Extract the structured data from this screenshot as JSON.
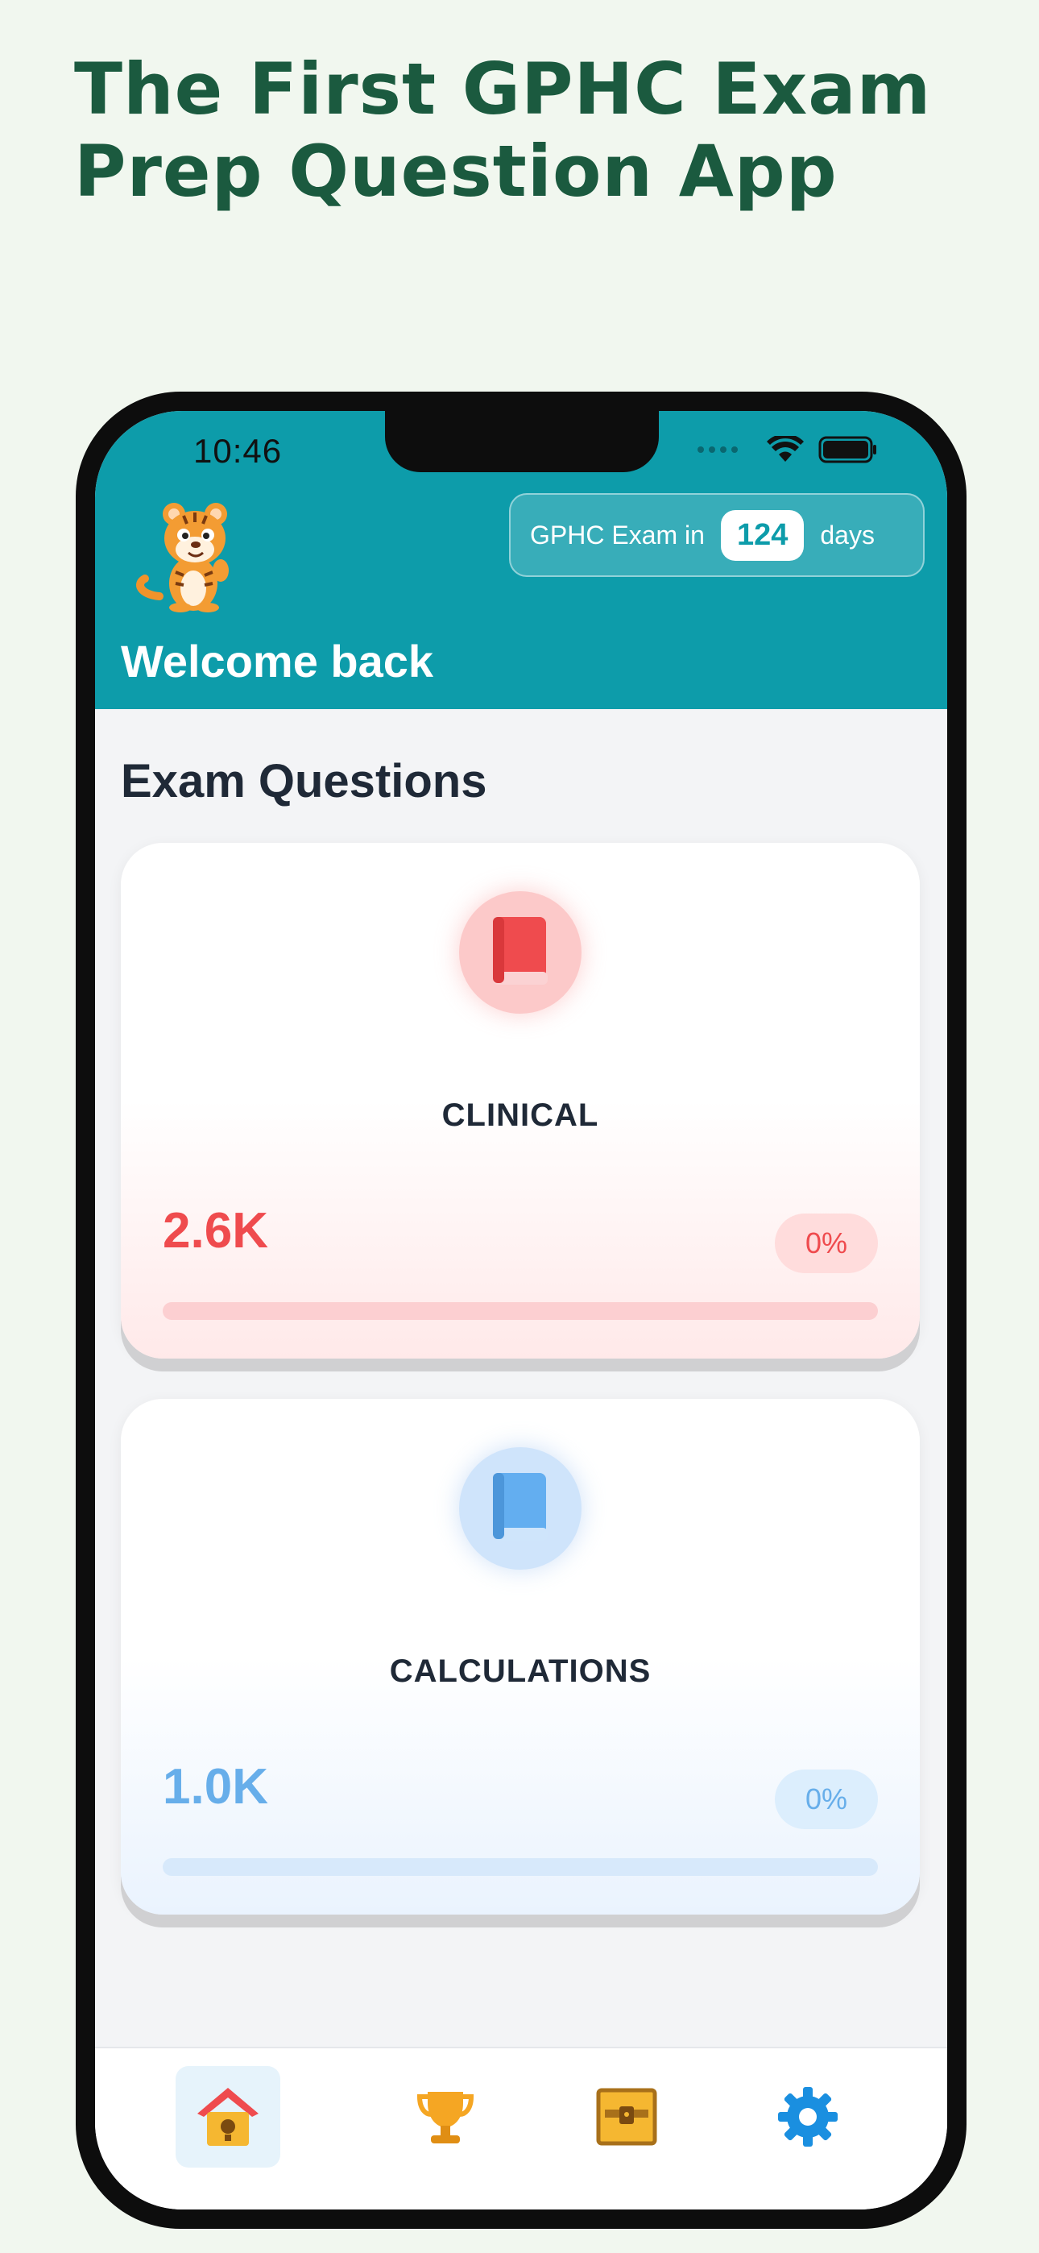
{
  "headline": {
    "line1": "The First GPHC Exam",
    "line2": "Prep Question App"
  },
  "status_bar": {
    "time": "10:46"
  },
  "header": {
    "exam_prefix": "GPHC Exam in",
    "exam_days": "124",
    "exam_suffix": "days",
    "welcome": "Welcome back"
  },
  "section_title": "Exam Questions",
  "cards": [
    {
      "title": "CLINICAL",
      "count": "2.6K",
      "percent": "0%",
      "progress": 0,
      "accent": "#ef4b4e",
      "icon": "book-icon"
    },
    {
      "title": "CALCULATIONS",
      "count": "1.0K",
      "percent": "0%",
      "progress": 0,
      "accent": "#67aeea",
      "icon": "book-icon"
    }
  ],
  "tabs": [
    {
      "icon": "birdhouse-home-icon",
      "active": true
    },
    {
      "icon": "trophy-icon",
      "active": false
    },
    {
      "icon": "treasure-chest-icon",
      "active": false
    },
    {
      "icon": "gear-icon",
      "active": false
    }
  ],
  "colors": {
    "page_bg": "#f1f7ef",
    "headline": "#1b5a3f",
    "header": "#0d9caa"
  }
}
